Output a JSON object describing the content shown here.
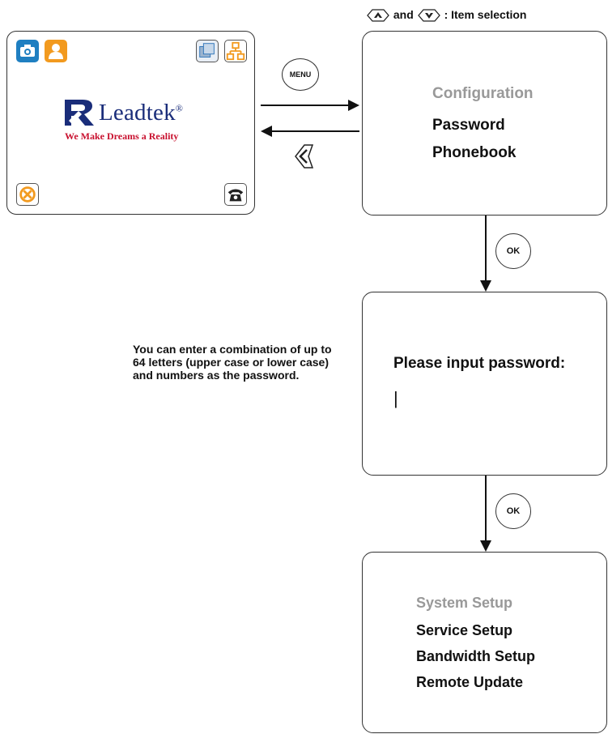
{
  "hint": {
    "joiner": "and",
    "text": ": Item selection",
    "up_icon": "up-arrow-key-icon",
    "down_icon": "down-arrow-key-icon"
  },
  "home_screen": {
    "logo_text": "Leadtek",
    "logo_mark": "®",
    "tagline": "We Make Dreams a Reality",
    "icons": [
      "camera-icon",
      "user-icon",
      "windows-icon",
      "network-icon",
      "cancel-icon",
      "phone-icon"
    ]
  },
  "buttons": {
    "menu": "MENU",
    "ok_1": "OK",
    "ok_2": "OK",
    "back_icon": "back-arrow-key-icon"
  },
  "menu_config": {
    "title": "Configuration",
    "items": [
      "Password",
      "Phonebook"
    ]
  },
  "password_screen": {
    "prompt": "Please input password:",
    "cursor": "|"
  },
  "note": "You can enter a combination of up to 64 letters (upper case or lower case) and numbers as the password.",
  "menu_system": {
    "title": "System Setup",
    "items": [
      "Service Setup",
      "Bandwidth Setup",
      "Remote Update"
    ]
  },
  "colors": {
    "camera": "#1f7fc1",
    "user": "#f29a1f",
    "windows": "#2b72b8",
    "network": "#f29a1f",
    "cancel": "#f29a1f",
    "logo_blue": "#1a2d7a",
    "tagline_red": "#c8102e",
    "menu_title_gray": "#999999"
  }
}
